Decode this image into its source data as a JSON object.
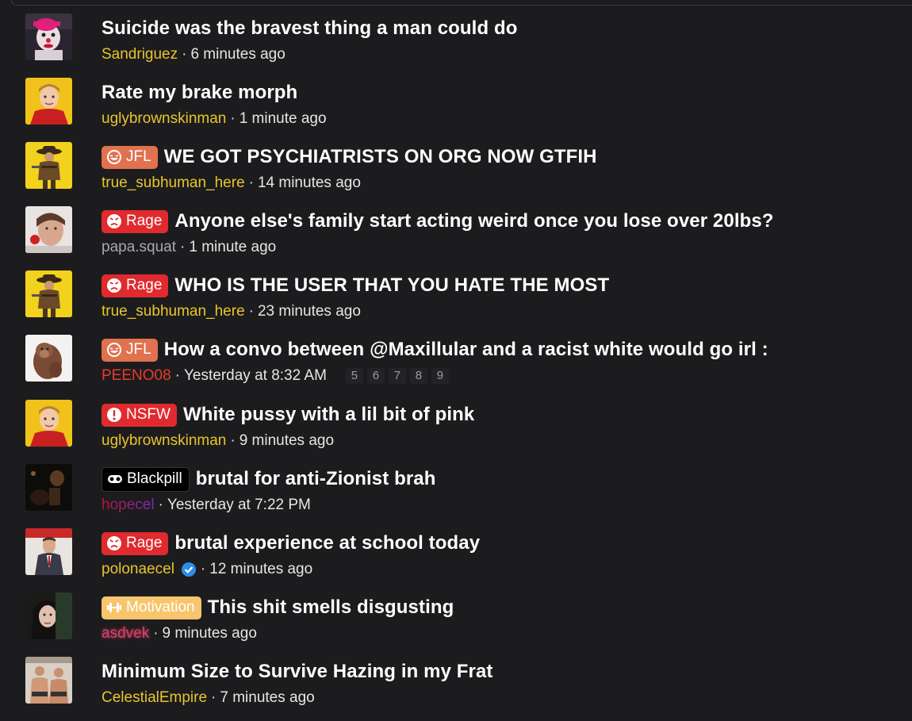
{
  "threads": [
    {
      "title": "Suicide was the bravest thing a man could do",
      "author": "Sandriguez",
      "time": "6 minutes ago",
      "prefix": null,
      "avatar_icon": "clown-avatar"
    },
    {
      "title": "Rate my brake morph",
      "author": "uglybrownskinman",
      "time": "1 minute ago",
      "prefix": null,
      "avatar_icon": "boy-avatar"
    },
    {
      "title": "WE GOT PSYCHIATRISTS ON ORG NOW GTFIH",
      "author": "true_subhuman_here",
      "time": "14 minutes ago",
      "prefix": "JFL",
      "avatar_icon": "cowboy-avatar"
    },
    {
      "title": "Anyone else's family start acting weird once you lose over 20lbs?",
      "author": "papa.squat",
      "time": "1 minute ago",
      "prefix": "Rage",
      "avatar_icon": "man-avatar"
    },
    {
      "title": "WHO IS THE USER THAT YOU HATE THE MOST",
      "author": "true_subhuman_here",
      "time": "23 minutes ago",
      "prefix": "Rage",
      "avatar_icon": "cowboy-avatar"
    },
    {
      "title": "How a convo between @Maxillular and a racist white would go irl :",
      "author": "PEENO08",
      "time": "Yesterday at 8:32 AM",
      "prefix": "JFL",
      "avatar_icon": "monkey-avatar",
      "pages": [
        "5",
        "6",
        "7",
        "8",
        "9"
      ]
    },
    {
      "title": "White pussy with a lil bit of pink",
      "author": "uglybrownskinman",
      "time": "9 minutes ago",
      "prefix": "NSFW",
      "avatar_icon": "boy-avatar"
    },
    {
      "title": "brutal for anti-Zionist brah",
      "author": "hopecel",
      "time": "Yesterday at 7:22 PM",
      "prefix": "Blackpill",
      "avatar_icon": "dark-avatar"
    },
    {
      "title": "brutal experience at school today",
      "author": "polonaecel",
      "time": "12 minutes ago",
      "prefix": "Rage",
      "verified": true,
      "avatar_icon": "suit-avatar"
    },
    {
      "title": "This shit smells disgusting",
      "author": "asdvek",
      "time": "9 minutes ago",
      "prefix": "Motivation",
      "avatar_icon": "girl-avatar"
    },
    {
      "title": "Minimum Size to Survive Hazing in my Frat",
      "author": "CelestialEmpire",
      "time": "7 minutes ago",
      "prefix": null,
      "avatar_icon": "wrestlers-avatar"
    }
  ],
  "separator": "·",
  "colors": {
    "background": "#1c1c1e",
    "username_default": "#e8c52c",
    "username_grey": "#a9a9ad",
    "username_red": "#ea3a2a",
    "prefix_jfl": "#e0724f",
    "prefix_rage": "#e02a2e",
    "prefix_nsfw": "#e02a2e",
    "prefix_blackpill": "#000000",
    "prefix_motivation": "#f7c56b",
    "verified": "#2d8ceb"
  }
}
